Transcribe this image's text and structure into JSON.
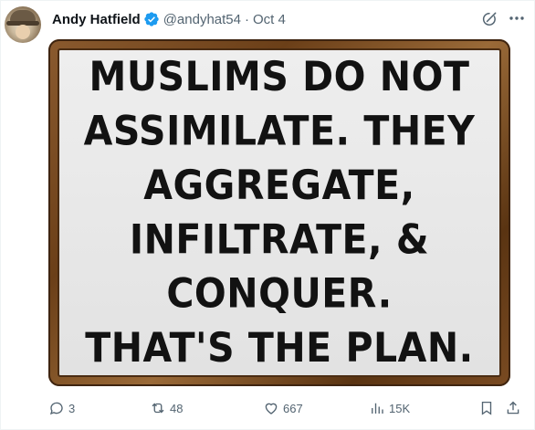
{
  "tweet": {
    "author_name": "Andy Hatfield",
    "handle": "@andyhat54",
    "separator": "·",
    "date": "Oct 4",
    "image_text_lines": [
      "MUSLIMS DO NOT",
      "ASSIMILATE. THEY",
      "AGGREGATE,",
      "INFILTRATE, &",
      "CONQUER.",
      "THAT'S THE PLAN."
    ],
    "stats": {
      "replies": "3",
      "reposts": "48",
      "likes": "667",
      "views": "15K"
    },
    "icons": {
      "avatar": "avatar",
      "verified": "verified-badge-icon",
      "grok": "grok-icon",
      "more": "more-icon",
      "reply": "reply-icon",
      "repost": "repost-icon",
      "like": "heart-icon",
      "views": "views-icon",
      "bookmark": "bookmark-icon",
      "share": "share-icon"
    },
    "colors": {
      "verified": "#1d9bf0",
      "muted": "#536471",
      "text": "#0f1419"
    }
  }
}
